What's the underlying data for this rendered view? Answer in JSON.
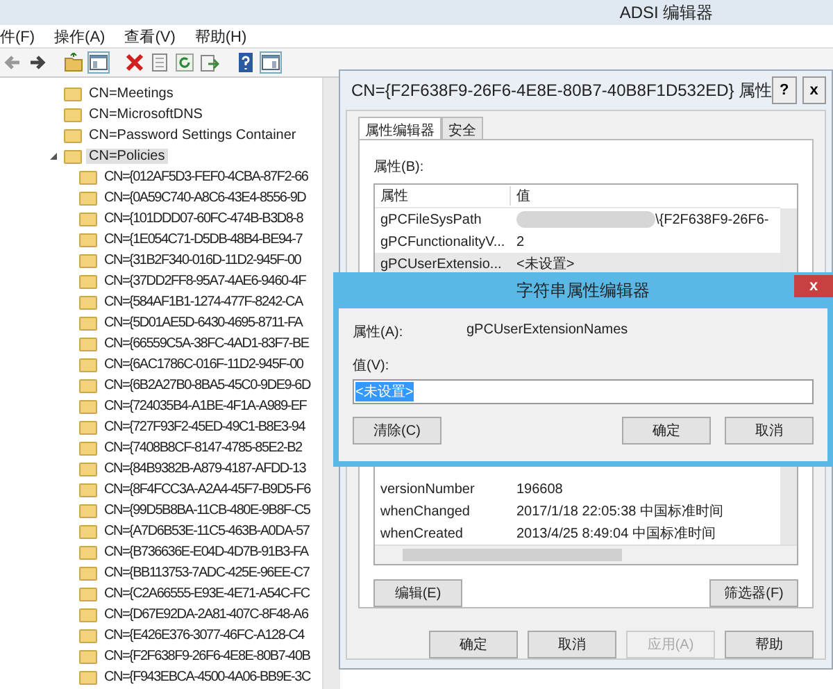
{
  "window": {
    "title": "ADSI 编辑器"
  },
  "menu": [
    "件(F)",
    "操作(A)",
    "查看(V)",
    "帮助(H)"
  ],
  "tree": {
    "items": [
      {
        "label": "CN=Meetings",
        "selected": false
      },
      {
        "label": "CN=MicrosoftDNS",
        "selected": false
      },
      {
        "label": "CN=Password Settings Container",
        "selected": false
      },
      {
        "label": "CN=Policies",
        "expanded": true,
        "selected": true,
        "children": [
          {
            "label": "CN={012AF5D3-FEF0-4CBA-87F2-66",
            "selected": false
          },
          {
            "label": "CN={0A59C740-A8C6-43E4-8556-9D",
            "selected": false
          },
          {
            "label": "CN={101DDD07-60FC-474B-B3D8-8",
            "selected": false
          },
          {
            "label": "CN={1E054C71-D5DB-48B4-BE94-7",
            "selected": false
          },
          {
            "label": "CN={31B2F340-016D-11D2-945F-00",
            "selected": false
          },
          {
            "label": "CN={37DD2FF8-95A7-4AE6-9460-4F",
            "selected": false
          },
          {
            "label": "CN={584AF1B1-1274-477F-8242-CA",
            "selected": false
          },
          {
            "label": "CN={5D01AE5D-6430-4695-8711-FA",
            "selected": false
          },
          {
            "label": "CN={66559C5A-38FC-4AD1-83F7-BE",
            "selected": false
          },
          {
            "label": "CN={6AC1786C-016F-11D2-945F-00",
            "selected": false
          },
          {
            "label": "CN={6B2A27B0-8BA5-45C0-9DE9-6D",
            "selected": false
          },
          {
            "label": "CN={724035B4-A1BE-4F1A-A989-EF",
            "selected": false
          },
          {
            "label": "CN={727F93F2-45ED-49C1-B8E3-94",
            "selected": false
          },
          {
            "label": "CN={7408B8CF-8147-4785-85E2-B2",
            "selected": false
          },
          {
            "label": "CN={84B9382B-A879-4187-AFDD-13",
            "selected": false
          },
          {
            "label": "CN={8F4FCC3A-A2A4-45F7-B9D5-F6",
            "selected": false
          },
          {
            "label": "CN={99D5B8BA-11CB-480E-9B8F-C5",
            "selected": false
          },
          {
            "label": "CN={A7D6B53E-11C5-463B-A0DA-57",
            "selected": false
          },
          {
            "label": "CN={B736636E-E04D-4D7B-91B3-FA",
            "selected": false
          },
          {
            "label": "CN={BB113753-7ADC-425E-96EE-C7",
            "selected": false
          },
          {
            "label": "CN={C2A66555-E93E-4E71-A54C-FC",
            "selected": false
          },
          {
            "label": "CN={D67E92DA-2A81-407C-8F48-A6",
            "selected": false
          },
          {
            "label": "CN={E426E376-3077-46FC-A128-C4",
            "selected": false
          },
          {
            "label": "CN={F2F638F9-26F6-4E8E-80B7-40B",
            "selected": false
          },
          {
            "label": "CN={F943EBCA-4500-4A06-BB9E-3C",
            "selected": false
          }
        ]
      }
    ]
  },
  "properties_dialog": {
    "title": "CN={F2F638F9-26F6-4E8E-80B7-40B8F1D532ED} 属性",
    "help_button": "?",
    "close_button": "x",
    "tabs": [
      {
        "label": "属性编辑器",
        "selected": true
      },
      {
        "label": "安全",
        "selected": false
      }
    ],
    "attributes_label": "属性(B):",
    "columns": [
      "属性",
      "值"
    ],
    "rows": [
      {
        "attribute": "gPCFileSysPath",
        "value": "\\{F2F638F9-26F6-",
        "redacted": true,
        "selected": false
      },
      {
        "attribute": "gPCFunctionalityV...",
        "value": "2",
        "redacted": false,
        "selected": false
      },
      {
        "attribute": "gPCUserExtensio...",
        "value": "<未设置>",
        "redacted": false,
        "selected": true
      },
      {
        "attribute": "versionNumber",
        "value": "196608",
        "redacted": false,
        "selected": false
      },
      {
        "attribute": "whenChanged",
        "value": "2017/1/18 22:05:38 中国标准时间",
        "redacted": false,
        "selected": false
      },
      {
        "attribute": "whenCreated",
        "value": "2013/4/25 8:49:04 中国标准时间",
        "redacted": false,
        "selected": false
      }
    ],
    "edit_button": "编辑(E)",
    "filter_button": "筛选器(F)",
    "buttons": [
      {
        "label": "确定",
        "disabled": false
      },
      {
        "label": "取消",
        "disabled": false
      },
      {
        "label": "应用(A)",
        "disabled": true
      },
      {
        "label": "帮助",
        "disabled": false
      }
    ]
  },
  "string_editor": {
    "title": "字符串属性编辑器",
    "close_button": "x",
    "attribute_label": "属性(A):",
    "attribute_value": "gPCUserExtensionNames",
    "value_label": "值(V):",
    "value": "<未设置>",
    "value_selected": true,
    "clear_button": "清除(C)",
    "ok_button": "确定",
    "cancel_button": "取消"
  }
}
